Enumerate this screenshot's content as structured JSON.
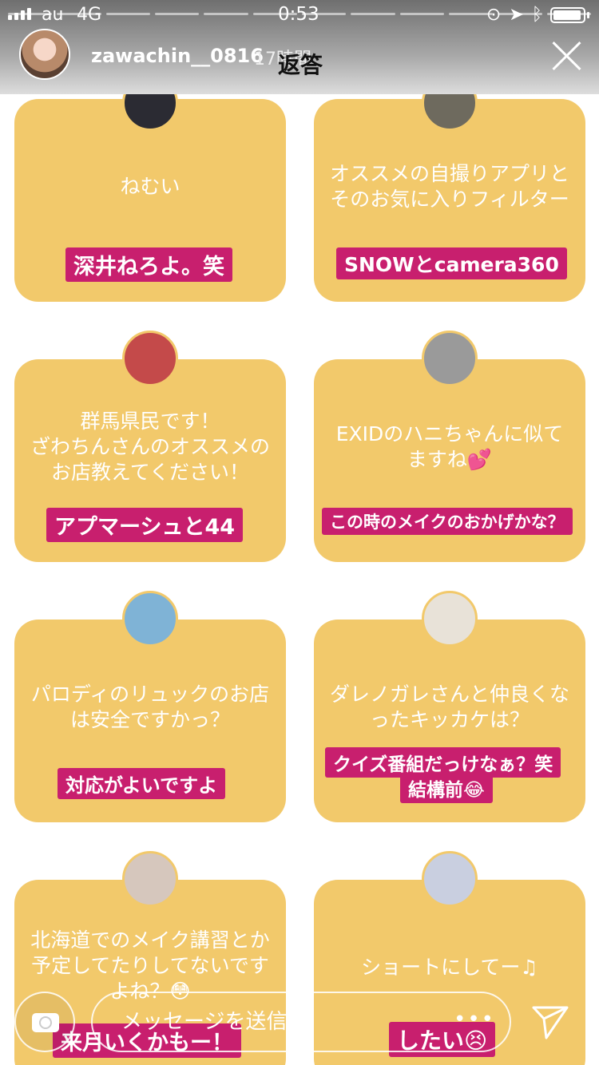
{
  "status_bar": {
    "carrier": "au",
    "network": "4G",
    "time": "0:53"
  },
  "header": {
    "username": "zawachin__0816",
    "time_ago": "17時間",
    "title": "返答"
  },
  "cards": [
    {
      "question": "ねむい",
      "answer": "深井ねろよ。笑",
      "avatar_color": "#2b2b33"
    },
    {
      "question": "オススメの自撮りアプリと\nそのお気に入りフィルター",
      "answer": "SNOWとcamera360",
      "avatar_color": "#6e6a5e"
    },
    {
      "question": "群馬県民です！\nざわちんさんのオススメの\nお店教えてください！",
      "answer": "アプマーシュと44",
      "avatar_color": "#c44a4a"
    },
    {
      "question": "EXIDのハニちゃんに似て\nますね💕",
      "answer": "この時のメイクのおかげかな？",
      "avatar_color": "#9a9a9a"
    },
    {
      "question": "パロディのリュックのお店\nは安全ですかっ？",
      "answer": "対応がよいですよ",
      "avatar_color": "#7fb3d6"
    },
    {
      "question": "ダレノガレさんと仲良くな\nったキッカケは？",
      "answer": "クイズ番組だっけなぁ？笑",
      "answer2": "結構前😂",
      "avatar_color": "#e8e2d8"
    },
    {
      "question": "北海道でのメイク講習とか\n予定してたりしてないです\nよね？😳",
      "answer": "来月いくかもー！",
      "avatar_color": "#d6c7bd"
    },
    {
      "question": "ショートにしてー♫",
      "answer": "したい😣",
      "avatar_color": "#c9cfe0"
    }
  ],
  "bottom_bar": {
    "message_placeholder": "メッセージを送信",
    "more": "•••"
  },
  "colors": {
    "card_bg": "#f2c96b",
    "answer_bg": "#c81f6e"
  }
}
